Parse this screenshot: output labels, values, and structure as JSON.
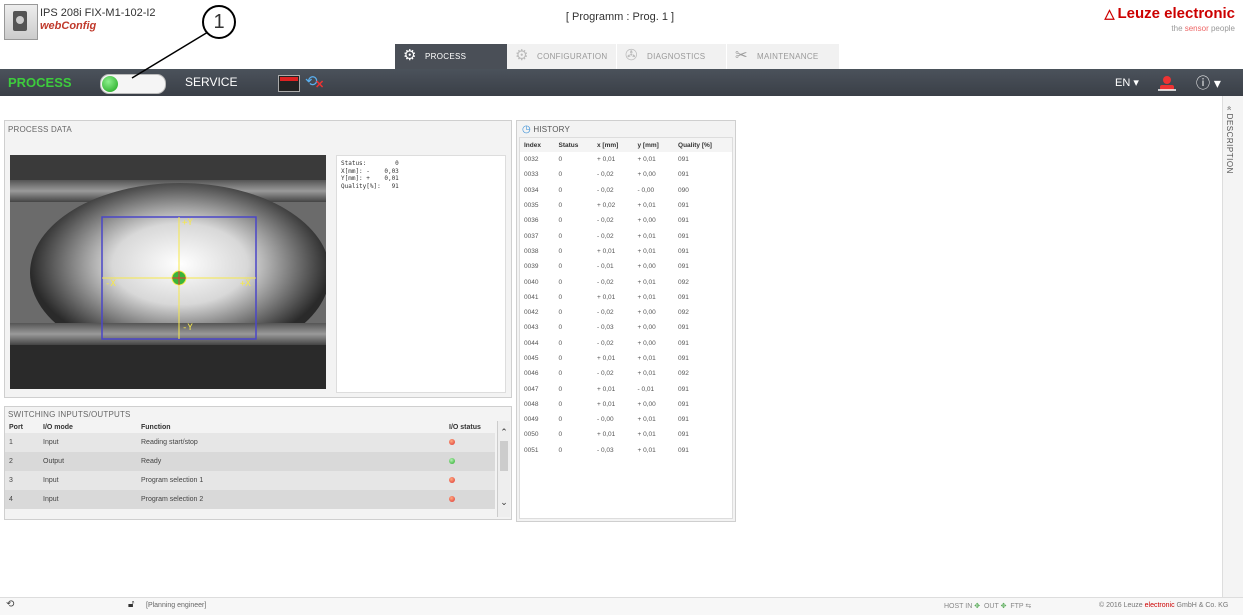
{
  "header": {
    "device_name": "IPS 208i FIX-M1-102-I2",
    "app_name": "webConfig",
    "program_title": "[ Programm : Prog. 1 ]",
    "brand": "Leuze electronic",
    "brand_tagline_prefix": "the ",
    "brand_tagline_red": "sensor",
    "brand_tagline_suffix": " people"
  },
  "annotation": {
    "callout_number": "1"
  },
  "tabs": [
    {
      "label": "PROCESS",
      "icon": "gear-icon",
      "active": true
    },
    {
      "label": "CONFIGURATION",
      "icon": "config-icon",
      "active": false
    },
    {
      "label": "DIAGNOSTICS",
      "icon": "diagnostics-icon",
      "active": false
    },
    {
      "label": "MAINTENANCE",
      "icon": "tools-icon",
      "active": false
    }
  ],
  "toolbar": {
    "mode_process": "PROCESS",
    "mode_service": "SERVICE",
    "toggle_state": "process",
    "language": "EN",
    "colors": {
      "process_green": "#3dcc3d",
      "bar": "#40464e"
    }
  },
  "side": {
    "description_label": "DESCRIPTION"
  },
  "process_data": {
    "title": "PROCESS DATA",
    "overlay": {
      "plus_y": "+Y",
      "minus_y": "-Y",
      "plus_x": "+X",
      "minus_x": "-X"
    },
    "info_text": "Status:        0\nX[mm]: -    0,03\nY[mm]: +    0,01\nQuality[%]:   91"
  },
  "io": {
    "title": "SWITCHING INPUTS/OUTPUTS",
    "headers": {
      "port": "Port",
      "mode": "I/O mode",
      "function": "Function",
      "status": "I/O status"
    },
    "rows": [
      {
        "port": "1",
        "mode": "Input",
        "function": "Reading start/stop",
        "status": "red"
      },
      {
        "port": "2",
        "mode": "Output",
        "function": "Ready",
        "status": "green"
      },
      {
        "port": "3",
        "mode": "Input",
        "function": "Program selection 1",
        "status": "red"
      },
      {
        "port": "4",
        "mode": "Input",
        "function": "Program selection 2",
        "status": "red"
      }
    ]
  },
  "history": {
    "title": "HISTORY",
    "headers": [
      "Index",
      "Status",
      "x [mm]",
      "y [mm]",
      "Quality [%]"
    ],
    "rows": [
      [
        "0032",
        "0",
        "+ 0,01",
        "+ 0,01",
        "091"
      ],
      [
        "0033",
        "0",
        "- 0,02",
        "+ 0,00",
        "091"
      ],
      [
        "0034",
        "0",
        "- 0,02",
        "- 0,00",
        "090"
      ],
      [
        "0035",
        "0",
        "+ 0,02",
        "+ 0,01",
        "091"
      ],
      [
        "0036",
        "0",
        "- 0,02",
        "+ 0,00",
        "091"
      ],
      [
        "0037",
        "0",
        "- 0,02",
        "+ 0,01",
        "091"
      ],
      [
        "0038",
        "0",
        "+ 0,01",
        "+ 0,01",
        "091"
      ],
      [
        "0039",
        "0",
        "- 0,01",
        "+ 0,00",
        "091"
      ],
      [
        "0040",
        "0",
        "- 0,02",
        "+ 0,01",
        "092"
      ],
      [
        "0041",
        "0",
        "+ 0,01",
        "+ 0,01",
        "091"
      ],
      [
        "0042",
        "0",
        "- 0,02",
        "+ 0,00",
        "092"
      ],
      [
        "0043",
        "0",
        "- 0,03",
        "+ 0,00",
        "091"
      ],
      [
        "0044",
        "0",
        "- 0,02",
        "+ 0,00",
        "091"
      ],
      [
        "0045",
        "0",
        "+ 0,01",
        "+ 0,01",
        "091"
      ],
      [
        "0046",
        "0",
        "- 0,02",
        "+ 0,01",
        "092"
      ],
      [
        "0047",
        "0",
        "+ 0,01",
        "- 0,01",
        "091"
      ],
      [
        "0048",
        "0",
        "+ 0,01",
        "+ 0,00",
        "091"
      ],
      [
        "0049",
        "0",
        "- 0,00",
        "+ 0,01",
        "091"
      ],
      [
        "0050",
        "0",
        "+ 0,01",
        "+ 0,01",
        "091"
      ],
      [
        "0051",
        "0",
        "- 0,03",
        "+ 0,01",
        "091"
      ]
    ]
  },
  "footer": {
    "user_role": "[Planning engineer]",
    "host_in": "HOST IN",
    "out": "OUT",
    "ftp": "FTP",
    "copyright_prefix": "© 2016 Leuze ",
    "copyright_red": "electronic",
    "copyright_suffix": " GmbH & Co. KG"
  }
}
